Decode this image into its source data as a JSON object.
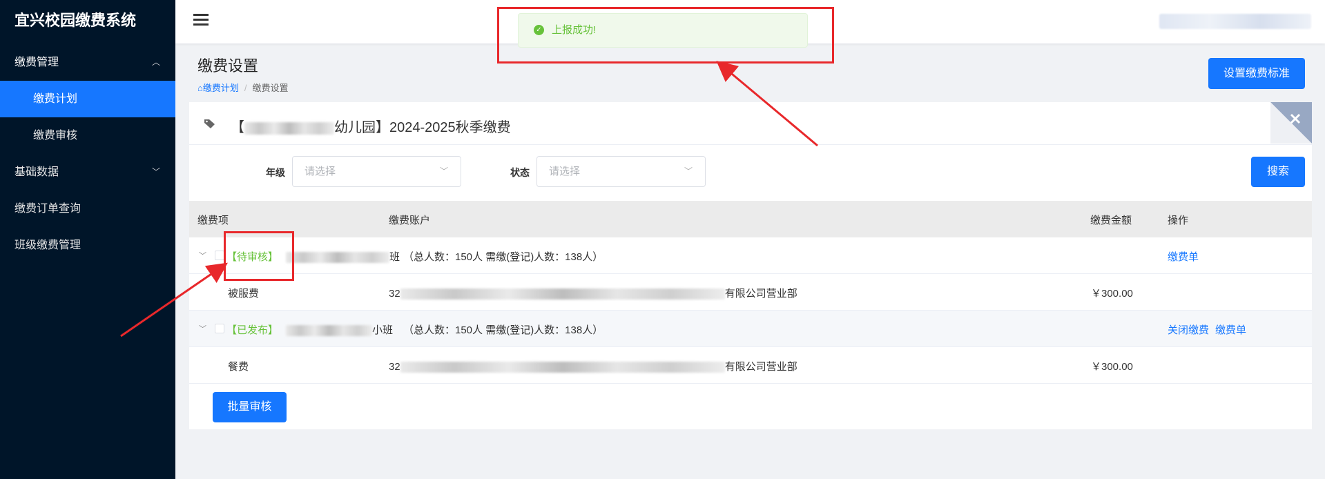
{
  "app": {
    "title": "宜兴校园缴费系统"
  },
  "sidebar": {
    "items": [
      {
        "label": "缴费管理",
        "chevron": "︿"
      },
      {
        "label": "缴费计划"
      },
      {
        "label": "缴费审核"
      },
      {
        "label": "基础数据",
        "chevron": "﹀"
      },
      {
        "label": "缴费订单查询"
      },
      {
        "label": "班级缴费管理"
      }
    ]
  },
  "toast": {
    "message": "上报成功!",
    "icon": "check-circle-icon",
    "color": "#67c23a"
  },
  "page": {
    "title": "缴费设置",
    "breadcrumb": [
      "缴费计划",
      "缴费设置"
    ],
    "set_standard_button": "设置缴费标准"
  },
  "card": {
    "title_prefix": "【",
    "title_suffix": "幼儿园】2024-2025秋季缴费"
  },
  "filters": {
    "grade_label": "年级",
    "grade_placeholder": "请选择",
    "status_label": "状态",
    "status_placeholder": "请选择",
    "search_button": "搜索"
  },
  "table": {
    "headers": [
      "缴费项",
      "缴费账户",
      "缴费金额",
      "操作"
    ],
    "groups": [
      {
        "status": "【待审核】",
        "class_suffix": "班",
        "summary": "（总人数：150人 需缴(登记)人数：138人）",
        "actions": [
          "缴费单"
        ],
        "item": {
          "name": "被服费",
          "account_prefix": "32",
          "account_suffix": "有限公司营业部",
          "amount": "￥300.00"
        }
      },
      {
        "status": "【已发布】",
        "class_suffix": "小班",
        "summary": "（总人数：150人 需缴(登记)人数：138人）",
        "actions": [
          "关闭缴费",
          "缴费单"
        ],
        "item": {
          "name": "餐费",
          "account_prefix": "32",
          "account_suffix": "有限公司营业部",
          "amount": "￥300.00"
        }
      }
    ]
  },
  "batch_button": "批量审核",
  "colors": {
    "primary": "#1677ff",
    "sidebar": "#001529",
    "success": "#67c23a",
    "annotation": "#e8282b"
  }
}
